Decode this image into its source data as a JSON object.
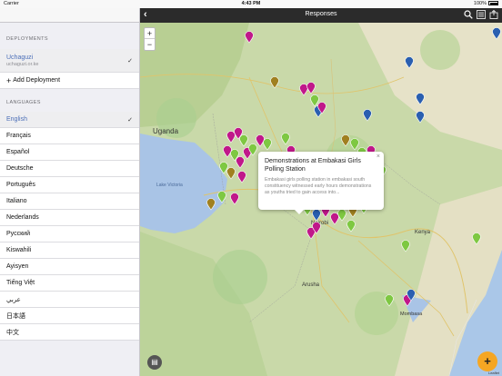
{
  "status": {
    "carrier": "Carrier",
    "time": "4:43 PM",
    "battery": "100%"
  },
  "nav": {
    "title": "Responses",
    "icons": [
      "back-icon",
      "search-icon",
      "list-icon",
      "export-icon"
    ]
  },
  "sidebar": {
    "deployments_header": "DEPLOYMENTS",
    "deployment": {
      "name": "Uchaguzi",
      "url": "uchaguzi.or.ke"
    },
    "add_label": "Add Deployment",
    "languages_header": "LANGUAGES",
    "languages": [
      "English",
      "Français",
      "Español",
      "Deutsche",
      "Português",
      "Italiano",
      "Nederlands",
      "Русский",
      "Kiswahili",
      "Ayisyen",
      "Tiếng Việt",
      "عربي",
      "日本語",
      "中文"
    ],
    "selected_language": "English"
  },
  "map": {
    "zoom_in": "+",
    "zoom_out": "−",
    "labels": [
      "Uganda",
      "Kenya",
      "Nairobi",
      "Arusha",
      "Mombasa",
      "Lake Victoria"
    ],
    "attribution": "Leaflet"
  },
  "popup": {
    "title": "Demonstrations at Embakasi Girls Polling Station",
    "body": "Embakasi girls polling station in embakasi south constituency witnessed early hours demonstrations as youths tried to gain access into...",
    "close": "×"
  },
  "fab": {
    "label": "+"
  },
  "colors": {
    "accent": "#4c6fb8",
    "navbar": "#2b2b2b",
    "fab": "#f5a623",
    "marker_pink": "#c0188a",
    "marker_green": "#7ec842",
    "marker_blue": "#2a5fb0"
  }
}
